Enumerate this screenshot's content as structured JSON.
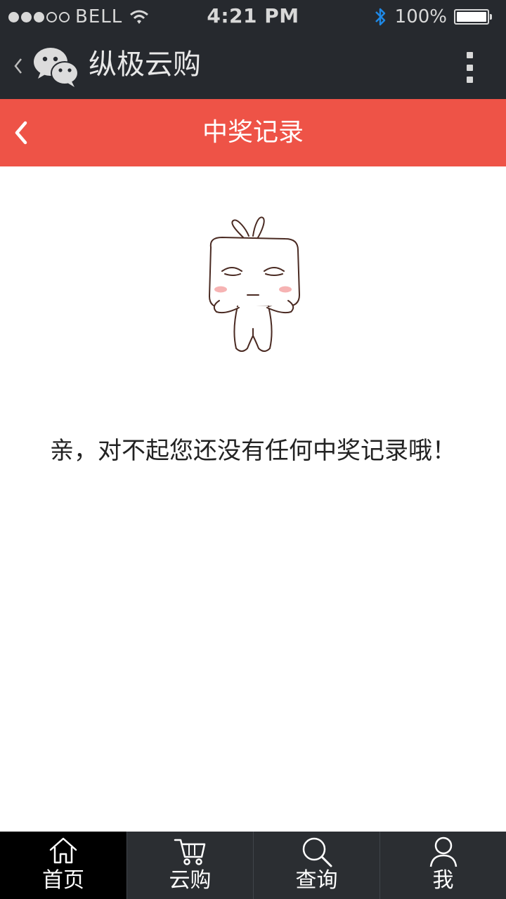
{
  "status_bar": {
    "carrier": "BELL",
    "time": "4:21 PM",
    "battery": "100%",
    "signal_icon": "signal-dots-icon",
    "wifi_icon": "wifi-icon",
    "bluetooth_icon": "bluetooth-icon",
    "battery_icon": "battery-icon"
  },
  "wechat_header": {
    "title": "纵极云购",
    "back_icon": "chevron-left-icon",
    "logo_icon": "wechat-logo-icon",
    "menu_icon": "more-vertical-icon"
  },
  "nav": {
    "title": "中奖记录",
    "back_icon": "chevron-left-icon"
  },
  "empty_state": {
    "illustration": "mascot-illustration",
    "message": "亲，对不起您还没有任何中奖记录哦！"
  },
  "tabs": [
    {
      "label": "首页",
      "icon": "home-icon",
      "active": true
    },
    {
      "label": "云购",
      "icon": "cart-icon",
      "active": false
    },
    {
      "label": "查询",
      "icon": "search-icon",
      "active": false
    },
    {
      "label": "我",
      "icon": "user-icon",
      "active": false
    }
  ],
  "colors": {
    "accent_red": "#ee5347",
    "dark_header": "#26292e",
    "tabbar": "#2b2e32",
    "bluetooth": "#1e88e5"
  }
}
